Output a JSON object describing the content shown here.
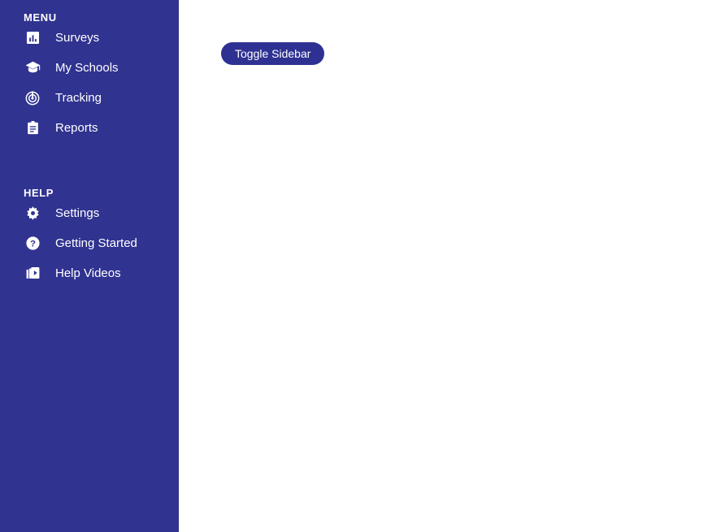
{
  "theme": {
    "sidebar_bg": "#303390",
    "button_bg": "#2e3192",
    "text_color": "#ffffff",
    "content_bg": "#ffffff"
  },
  "sidebar": {
    "sections": [
      {
        "title": "MENU",
        "items": [
          {
            "label": "Surveys",
            "icon": "bar-chart-box-icon"
          },
          {
            "label": "My Schools",
            "icon": "graduation-cap-icon"
          },
          {
            "label": "Tracking",
            "icon": "radar-target-icon"
          },
          {
            "label": "Reports",
            "icon": "clipboard-icon"
          }
        ]
      },
      {
        "title": "HELP",
        "items": [
          {
            "label": "Settings",
            "icon": "gear-icon"
          },
          {
            "label": "Getting Started",
            "icon": "question-circle-icon"
          },
          {
            "label": "Help Videos",
            "icon": "video-library-icon"
          }
        ]
      }
    ]
  },
  "main": {
    "toggle_sidebar_label": "Toggle Sidebar"
  }
}
